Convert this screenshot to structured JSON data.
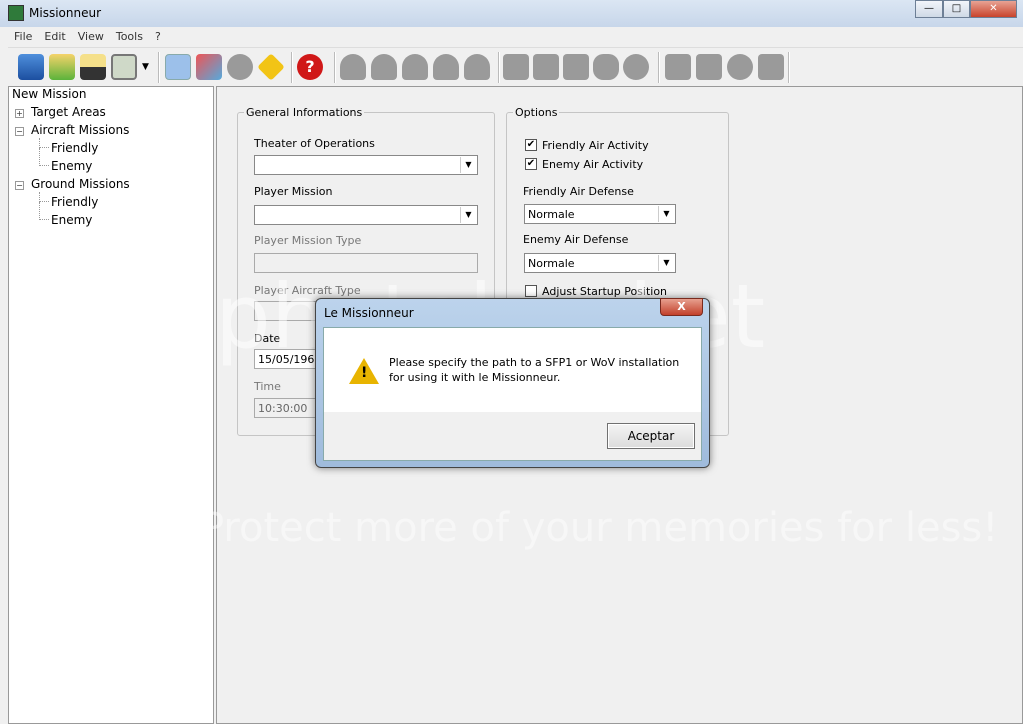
{
  "window": {
    "title": "Missionneur",
    "min": "—",
    "max": "□",
    "close": "✕"
  },
  "menu": [
    "File",
    "Edit",
    "View",
    "Tools",
    "?"
  ],
  "tree": {
    "root": "New Mission",
    "items": [
      {
        "label": "Target Areas",
        "expander": "+"
      },
      {
        "label": "Aircraft Missions",
        "expander": "−"
      },
      {
        "label": "Friendly"
      },
      {
        "label": "Enemy"
      },
      {
        "label": "Ground Missions",
        "expander": "−"
      },
      {
        "label": "Friendly"
      },
      {
        "label": "Enemy"
      }
    ]
  },
  "general": {
    "legend": "General Informations",
    "theater_label": "Theater of Operations",
    "theater_value": "",
    "player_mission_label": "Player Mission",
    "player_mission_value": "",
    "mission_type_label": "Player Mission Type",
    "aircraft_type_label": "Player Aircraft Type",
    "date_label": "Date",
    "date_value": "15/05/1968",
    "time_label": "Time",
    "time_value": "10:30:00"
  },
  "options": {
    "legend": "Options",
    "friendly_air_activity": "Friendly Air Activity",
    "friendly_air_activity_checked": true,
    "enemy_air_activity": "Enemy Air Activity",
    "enemy_air_activity_checked": true,
    "friendly_air_defense_label": "Friendly Air Defense",
    "friendly_air_defense_value": "Normale",
    "enemy_air_defense_label": "Enemy Air Defense",
    "enemy_air_defense_value": "Normale",
    "adjust_startup": "Adjust Startup Position",
    "adjust_startup_checked": false,
    "check": "✔"
  },
  "dialog": {
    "title": "Le Missionneur",
    "close": "X",
    "message_line1": "Please specify the path to a SFP1 or WoV installation",
    "message_line2": "for using it with le Missionneur.",
    "ok": "Aceptar",
    "warn": "!"
  },
  "watermark": {
    "brand": "photobucket",
    "slogan": "Protect more of your memories for less!"
  },
  "colors": {
    "toolbar_gray": "#9a9a9a",
    "help_red": "#d01818"
  }
}
